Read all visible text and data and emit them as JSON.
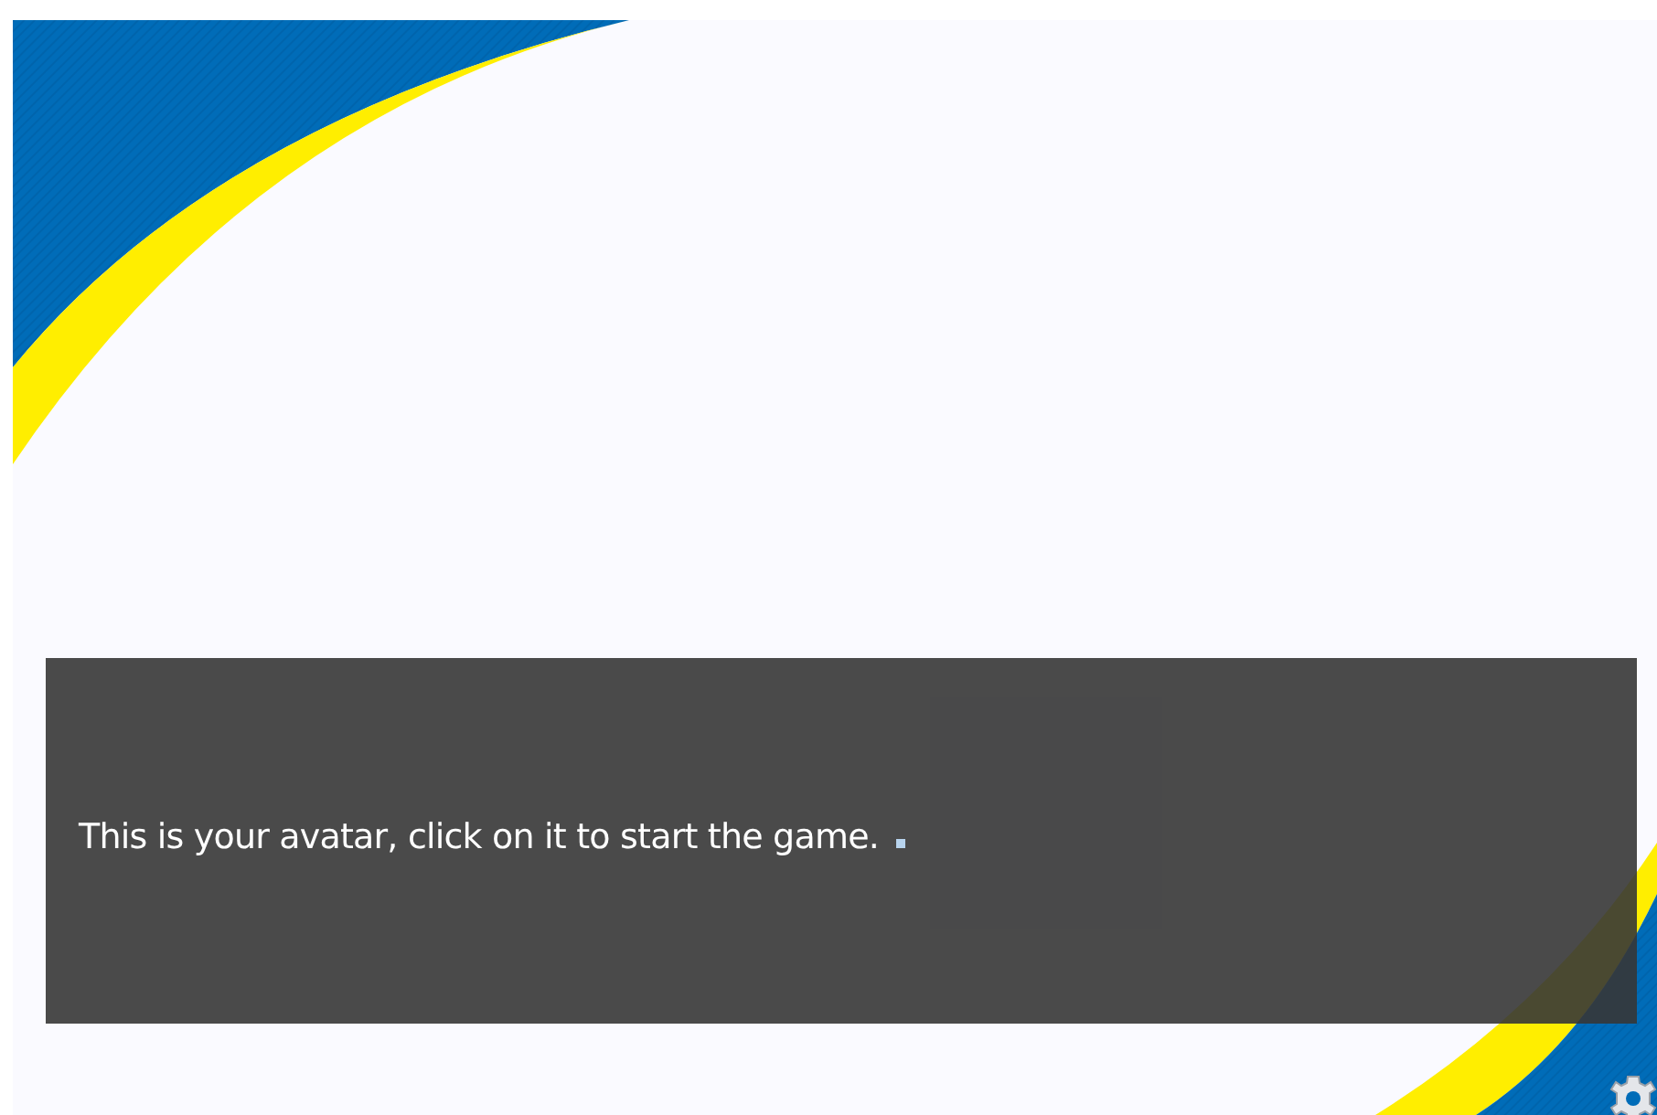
{
  "dialog": {
    "text": "This is your avatar, click on it to start the game."
  }
}
